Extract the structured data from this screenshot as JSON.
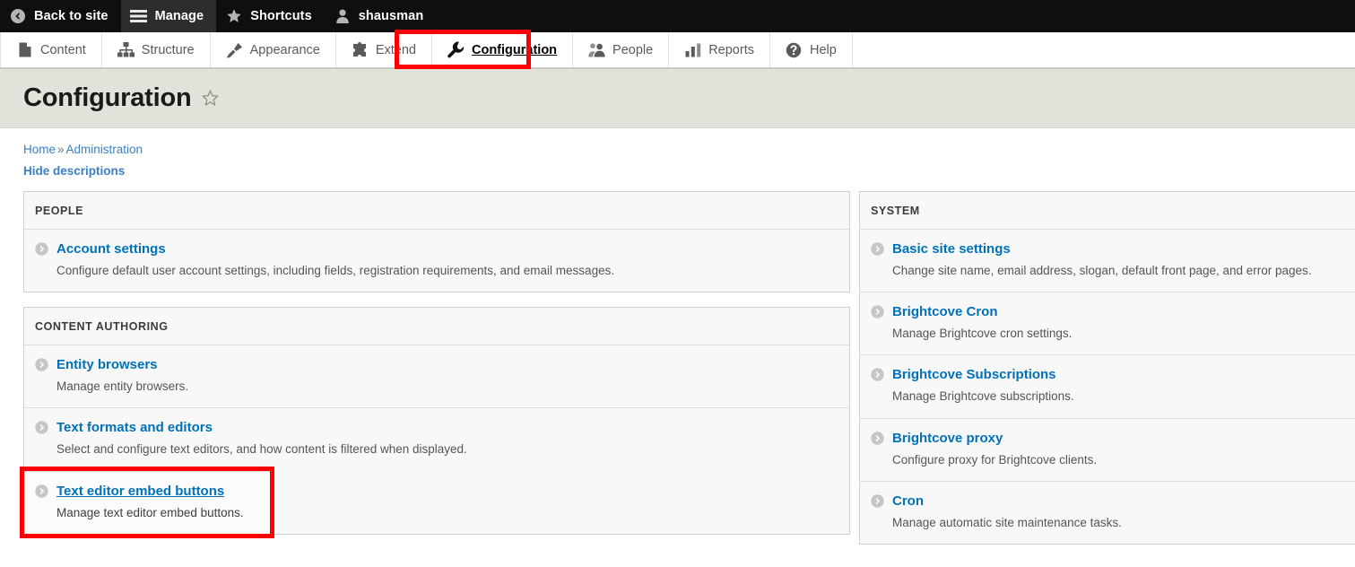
{
  "admin_toolbar": {
    "items": [
      {
        "label": "Back to site",
        "icon": "back-circle-icon",
        "active": false
      },
      {
        "label": "Manage",
        "icon": "hamburger-icon",
        "active": true
      },
      {
        "label": "Shortcuts",
        "icon": "star-icon",
        "active": false
      },
      {
        "label": "shausman",
        "icon": "user-icon",
        "active": false
      }
    ]
  },
  "menu_tabs": {
    "items": [
      {
        "label": "Content",
        "icon": "file-icon",
        "current": false
      },
      {
        "label": "Structure",
        "icon": "sitemap-icon",
        "current": false
      },
      {
        "label": "Appearance",
        "icon": "paintbrush-icon",
        "current": false
      },
      {
        "label": "Extend",
        "icon": "puzzle-icon",
        "current": false
      },
      {
        "label": "Configuration",
        "icon": "wrench-icon",
        "current": true
      },
      {
        "label": "People",
        "icon": "people-icon",
        "current": false
      },
      {
        "label": "Reports",
        "icon": "bar-chart-icon",
        "current": false
      },
      {
        "label": "Help",
        "icon": "question-circle-icon",
        "current": false
      }
    ]
  },
  "header": {
    "title": "Configuration",
    "star_icon": "favorite-star-icon"
  },
  "breadcrumb": {
    "home": "Home",
    "separator": "»",
    "administration": "Administration"
  },
  "hide_descriptions_label": "Hide descriptions",
  "columns": {
    "left": [
      {
        "heading": "PEOPLE",
        "entries": [
          {
            "title": "Account settings",
            "description": "Configure default user account settings, including fields, registration requirements, and email messages.",
            "hovered": false,
            "annotated": false
          }
        ]
      },
      {
        "heading": "CONTENT AUTHORING",
        "entries": [
          {
            "title": "Entity browsers",
            "description": "Manage entity browsers.",
            "hovered": false,
            "annotated": false
          },
          {
            "title": "Text formats and editors",
            "description": "Select and configure text editors, and how content is filtered when displayed.",
            "hovered": false,
            "annotated": false
          },
          {
            "title": "Text editor embed buttons",
            "description": "Manage text editor embed buttons.",
            "hovered": true,
            "annotated": true
          }
        ]
      }
    ],
    "right": [
      {
        "heading": "SYSTEM",
        "entries": [
          {
            "title": "Basic site settings",
            "description": "Change site name, email address, slogan, default front page, and error pages.",
            "hovered": false,
            "annotated": false
          },
          {
            "title": "Brightcove Cron",
            "description": "Manage Brightcove cron settings.",
            "hovered": false,
            "annotated": false
          },
          {
            "title": "Brightcove Subscriptions",
            "description": "Manage Brightcove subscriptions.",
            "hovered": false,
            "annotated": false
          },
          {
            "title": "Brightcove proxy",
            "description": "Configure proxy for Brightcove clients.",
            "hovered": false,
            "annotated": false
          },
          {
            "title": "Cron",
            "description": "Manage automatic site maintenance tasks.",
            "hovered": false,
            "annotated": false
          }
        ]
      }
    ]
  },
  "colors": {
    "toolbar_bg": "#0f0f0f",
    "toolbar_active": "#2d2d2d",
    "title_band": "#e2e2da",
    "link_blue": "#0071b8",
    "crumb_blue": "#3b7fc4",
    "annotation_red": "#fb0007",
    "panel_bg": "#f8f8f8"
  }
}
